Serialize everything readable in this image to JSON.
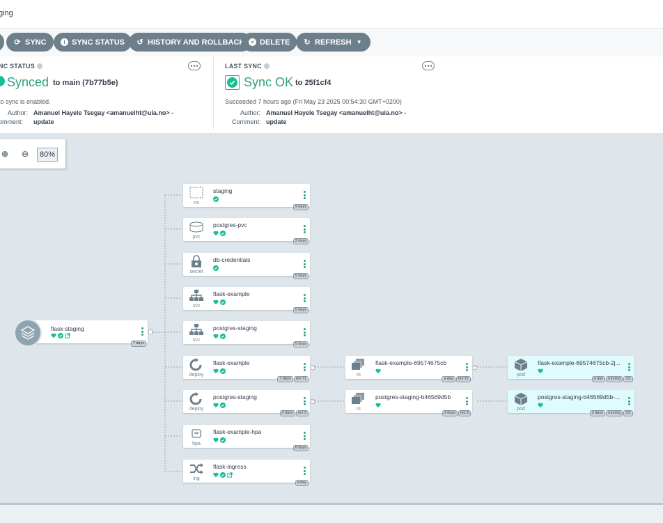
{
  "page": {
    "title": "ging"
  },
  "toolbar": {
    "sync": "SYNC",
    "sync_status": "SYNC STATUS",
    "history": "HISTORY AND ROLLBACK",
    "delete": "DELETE",
    "refresh": "REFRESH"
  },
  "sync_status": {
    "label": "NC STATUS",
    "status": "Synced",
    "to": "to main (7b77b5e)",
    "auto": "to sync is enabled.",
    "author_label": "Author:",
    "author": "Amanuel Hayele Tsegay <amanuelht@uia.no> -",
    "comment_label": "omment:",
    "comment": "update"
  },
  "last_sync": {
    "label": "LAST SYNC",
    "status": "Sync OK",
    "to": "to 25f1cf4",
    "succeeded": "Succeeded 7 hours ago (Fri May 23 2025 00:54:30 GMT+0200)",
    "author_label": "Author:",
    "author": "Amanuel Hayele Tsegay <amanuelht@uia.no> -",
    "comment_label": "Comment:",
    "comment": "update"
  },
  "zoom": {
    "value": "80%"
  },
  "colors": {
    "healthy": "#18be94",
    "button": "#6d7f8b",
    "canvas": "#dee6eb",
    "pod_bg": "#dffbfb"
  },
  "app": {
    "name": "flask-staging",
    "age": "7 days"
  },
  "resources": [
    {
      "name": "staging",
      "kind": "ns",
      "icon": "namespace-icon",
      "tags": [
        "9 days"
      ],
      "heart": false,
      "ext": false
    },
    {
      "name": "postgres-pvc",
      "kind": "pvc",
      "icon": "pvc-icon",
      "tags": [
        "3 days"
      ],
      "heart": true,
      "ext": false
    },
    {
      "name": "db-credentials",
      "kind": "secret",
      "icon": "secret-icon",
      "tags": [
        "5 days"
      ],
      "heart": false,
      "ext": false
    },
    {
      "name": "flask-example",
      "kind": "svc",
      "icon": "service-icon",
      "tags": [
        "5 days"
      ],
      "heart": true,
      "ext": false
    },
    {
      "name": "postgres-staging",
      "kind": "svc",
      "icon": "service-icon",
      "tags": [
        "5 days"
      ],
      "heart": true,
      "ext": false
    },
    {
      "name": "flask-example",
      "kind": "deploy",
      "icon": "deploy-icon",
      "tags": [
        "7 days",
        "rev:71"
      ],
      "heart": true,
      "ext": false
    },
    {
      "name": "postgres-staging",
      "kind": "deploy",
      "icon": "deploy-icon",
      "tags": [
        "3 days",
        "rev:3"
      ],
      "heart": true,
      "ext": false
    },
    {
      "name": "flask-example-hpa",
      "kind": "hpa",
      "icon": "hpa-icon",
      "tags": [
        "8 days"
      ],
      "heart": true,
      "ext": false
    },
    {
      "name": "flask-ingress",
      "kind": "ing",
      "icon": "ingress-icon",
      "tags": [
        "a day"
      ],
      "heart": true,
      "ext": true
    }
  ],
  "replicasets": [
    {
      "name": "flask-example-69574675cb",
      "kind": "rs",
      "tags": [
        "a day",
        "rev:71"
      ]
    },
    {
      "name": "postgres-staging-b46569d5b",
      "kind": "rs",
      "tags": [
        "3 days",
        "rev:3"
      ]
    }
  ],
  "pods": [
    {
      "name": "flask-example-69574675cb-2j...",
      "kind": "pod",
      "tags": [
        "a day",
        "running",
        "1/1"
      ]
    },
    {
      "name": "postgres-staging-b46569d5b-...",
      "kind": "pod",
      "tags": [
        "3 days",
        "running",
        "1/1"
      ]
    }
  ]
}
